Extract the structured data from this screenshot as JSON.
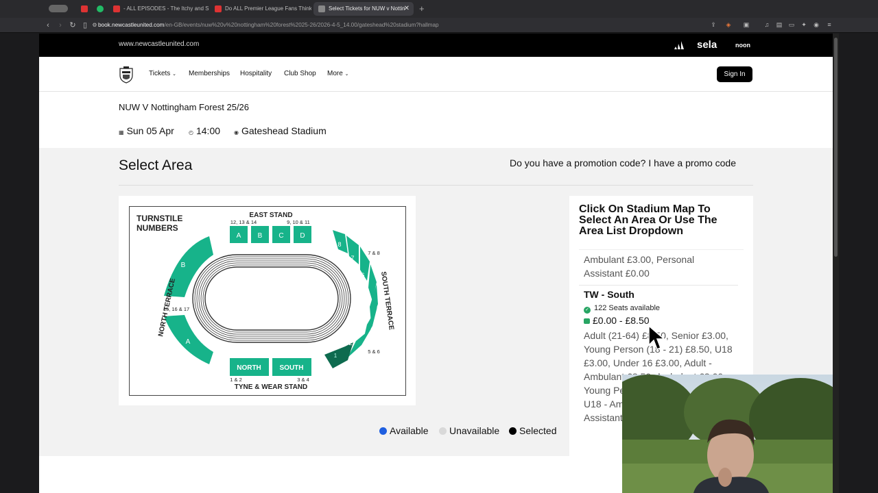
{
  "browser": {
    "tabs": [
      {
        "title": "- ALL EPISODES - The Itchy and S"
      },
      {
        "title": "Do ALL Premier League Fans Think"
      },
      {
        "title": "Select Tickets for NUW v Nottin"
      }
    ],
    "url_host": "book.newcastleunited.com",
    "url_path": "/en-GB/events/nuw%20v%20nottingham%20forest%2025-26/2026-4-5_14.00/gateshead%20stadium?hallmap"
  },
  "topstrip": {
    "site": "www.newcastleunited.com",
    "sponsor_sela": "sela",
    "sponsor_noon": "noon"
  },
  "nav": {
    "tickets": "Tickets",
    "memberships": "Memberships",
    "hospitality": "Hospitality",
    "club_shop": "Club Shop",
    "more": "More",
    "sign_in": "Sign In"
  },
  "event": {
    "title": "NUW V Nottingham Forest 25/26",
    "date": "Sun 05 Apr",
    "time": "14:00",
    "venue": "Gateshead Stadium"
  },
  "select_area": {
    "title": "Select Area",
    "promo_question": "Do you have a promotion code?",
    "promo_link": "I have a promo code"
  },
  "map": {
    "turnstile_line1": "TURNSTILE",
    "turnstile_line2": "NUMBERS",
    "east_stand": "EAST STAND",
    "east_numbers_left": "12, 13 & 14",
    "east_numbers_right": "9, 10 & 11",
    "blocks_east": [
      "A",
      "B",
      "C",
      "D"
    ],
    "north_terrace": "NORTH TERRACE",
    "north_numbers": "15, 16 & 17",
    "north_blocks": [
      "B",
      "A"
    ],
    "south_terrace": "SOUTH TERRACE",
    "south_numbers_top": "7 & 8",
    "south_numbers_bottom": "5 & 6",
    "south_blocks": [
      "8",
      "7",
      "6",
      "5",
      "4",
      "3",
      "2",
      "1"
    ],
    "bottom_north": "NORTH",
    "bottom_south": "SOUTH",
    "bottom_north_num": "1 & 2",
    "bottom_south_num": "3 & 4",
    "tyne_wear": "TYNE & WEAR STAND"
  },
  "panel": {
    "title": "Click On Stadium Map To Select An Area Or Use The Area List Dropdown",
    "previous_prices": "Ambulant  £3.00, Personal Assistant  £0.00",
    "area_name": "TW - South",
    "seats_available": "122 Seats available",
    "price_range": "£0.00 - £8.50",
    "prices": "Adult (21-64)  £8.50, Senior  £3.00, Young Person (18 - 21)  £8.50, U18  £3.00, Under 16  £3.00, Adult - Ambulant  £8.50, Ambulant  £3.00, Young Person - Ambulant  £8.50, U18 - Ambulant  £3.00, Personal Assistant  £0.00"
  },
  "legend": {
    "available": "Available",
    "unavailable": "Unavailable",
    "selected": "Selected"
  },
  "colors": {
    "block_green": "#17b38a",
    "block_selected": "#0e6b4f",
    "available_blue": "#1f5fe0",
    "unavailable_grey": "#d9d9d9",
    "selected_black": "#000000"
  }
}
